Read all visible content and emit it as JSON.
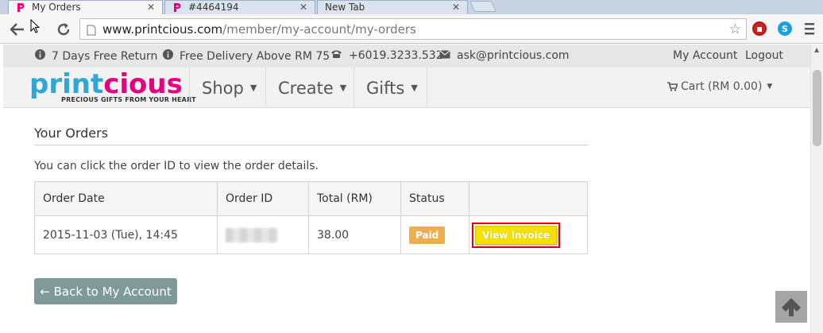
{
  "browser": {
    "tabs": [
      {
        "title": "My Orders",
        "active": true
      },
      {
        "title": "#4464194",
        "active": false
      },
      {
        "title": "New Tab",
        "active": false
      }
    ],
    "url_host": "www.printcious.com",
    "url_path": "/member/my-account/my-orders"
  },
  "topbar": {
    "return": "7 Days Free Return",
    "delivery": "Free Delivery Above RM 75",
    "phone": "+6019.3233.532",
    "email": "ask@printcious.com",
    "my_account": "My Account",
    "logout": "Logout"
  },
  "navbar": {
    "logo_text_p": "print",
    "logo_text_c": "cious",
    "tagline": "PRECIOUS GIFTS FROM YOUR HEART",
    "menu": [
      "Shop",
      "Create",
      "Gifts"
    ],
    "cart": "Cart (RM 0.00)"
  },
  "main": {
    "title": "Your Orders",
    "hint": "You can click the order ID to view the order details.",
    "table": {
      "headers": [
        "Order Date",
        "Order ID",
        "Total (RM)",
        "Status",
        ""
      ],
      "rows": [
        {
          "date": "2015-11-03 (Tue), 14:45",
          "order_id": "",
          "total": "38.00",
          "status": "Paid",
          "action": "View Invoice"
        }
      ]
    },
    "back_button": "← Back to My Account"
  },
  "colors": {
    "brand_blue": "#2fa6d6",
    "brand_pink": "#e6007e",
    "paid_badge": "#f0ad4e",
    "invoice_button": "#f5e000",
    "highlight": "#e0001b",
    "back_button": "#7f9999"
  },
  "icons": [
    "back-arrow-icon",
    "reload-icon",
    "page-icon",
    "star-icon",
    "info-icon",
    "phone-icon",
    "envelope-icon",
    "cart-icon",
    "caret-down-icon",
    "arrow-up-icon"
  ]
}
